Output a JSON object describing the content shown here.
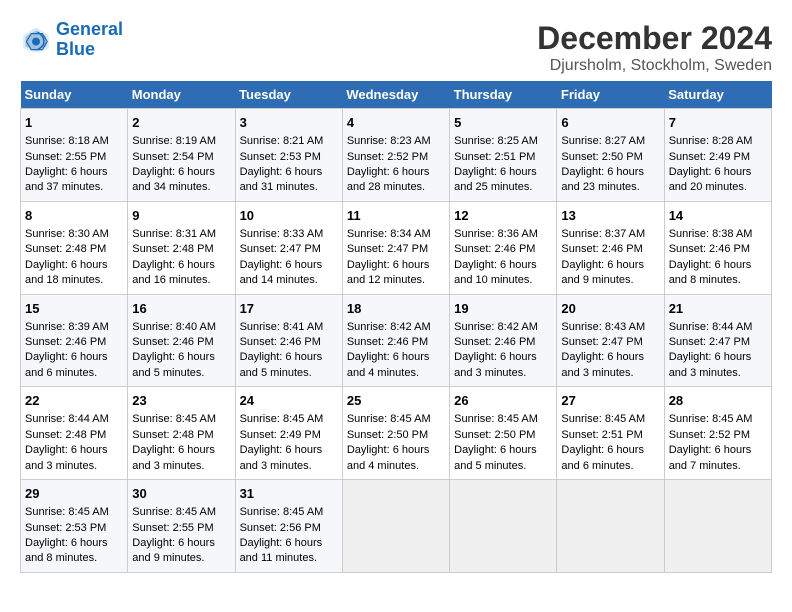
{
  "logo": {
    "line1": "General",
    "line2": "Blue"
  },
  "title": "December 2024",
  "subtitle": "Djursholm, Stockholm, Sweden",
  "days_header": [
    "Sunday",
    "Monday",
    "Tuesday",
    "Wednesday",
    "Thursday",
    "Friday",
    "Saturday"
  ],
  "weeks": [
    [
      {
        "day": "1",
        "sunrise": "8:18 AM",
        "sunset": "2:55 PM",
        "daylight": "6 hours and 37 minutes."
      },
      {
        "day": "2",
        "sunrise": "8:19 AM",
        "sunset": "2:54 PM",
        "daylight": "6 hours and 34 minutes."
      },
      {
        "day": "3",
        "sunrise": "8:21 AM",
        "sunset": "2:53 PM",
        "daylight": "6 hours and 31 minutes."
      },
      {
        "day": "4",
        "sunrise": "8:23 AM",
        "sunset": "2:52 PM",
        "daylight": "6 hours and 28 minutes."
      },
      {
        "day": "5",
        "sunrise": "8:25 AM",
        "sunset": "2:51 PM",
        "daylight": "6 hours and 25 minutes."
      },
      {
        "day": "6",
        "sunrise": "8:27 AM",
        "sunset": "2:50 PM",
        "daylight": "6 hours and 23 minutes."
      },
      {
        "day": "7",
        "sunrise": "8:28 AM",
        "sunset": "2:49 PM",
        "daylight": "6 hours and 20 minutes."
      }
    ],
    [
      {
        "day": "8",
        "sunrise": "8:30 AM",
        "sunset": "2:48 PM",
        "daylight": "6 hours and 18 minutes."
      },
      {
        "day": "9",
        "sunrise": "8:31 AM",
        "sunset": "2:48 PM",
        "daylight": "6 hours and 16 minutes."
      },
      {
        "day": "10",
        "sunrise": "8:33 AM",
        "sunset": "2:47 PM",
        "daylight": "6 hours and 14 minutes."
      },
      {
        "day": "11",
        "sunrise": "8:34 AM",
        "sunset": "2:47 PM",
        "daylight": "6 hours and 12 minutes."
      },
      {
        "day": "12",
        "sunrise": "8:36 AM",
        "sunset": "2:46 PM",
        "daylight": "6 hours and 10 minutes."
      },
      {
        "day": "13",
        "sunrise": "8:37 AM",
        "sunset": "2:46 PM",
        "daylight": "6 hours and 9 minutes."
      },
      {
        "day": "14",
        "sunrise": "8:38 AM",
        "sunset": "2:46 PM",
        "daylight": "6 hours and 8 minutes."
      }
    ],
    [
      {
        "day": "15",
        "sunrise": "8:39 AM",
        "sunset": "2:46 PM",
        "daylight": "6 hours and 6 minutes."
      },
      {
        "day": "16",
        "sunrise": "8:40 AM",
        "sunset": "2:46 PM",
        "daylight": "6 hours and 5 minutes."
      },
      {
        "day": "17",
        "sunrise": "8:41 AM",
        "sunset": "2:46 PM",
        "daylight": "6 hours and 5 minutes."
      },
      {
        "day": "18",
        "sunrise": "8:42 AM",
        "sunset": "2:46 PM",
        "daylight": "6 hours and 4 minutes."
      },
      {
        "day": "19",
        "sunrise": "8:42 AM",
        "sunset": "2:46 PM",
        "daylight": "6 hours and 3 minutes."
      },
      {
        "day": "20",
        "sunrise": "8:43 AM",
        "sunset": "2:47 PM",
        "daylight": "6 hours and 3 minutes."
      },
      {
        "day": "21",
        "sunrise": "8:44 AM",
        "sunset": "2:47 PM",
        "daylight": "6 hours and 3 minutes."
      }
    ],
    [
      {
        "day": "22",
        "sunrise": "8:44 AM",
        "sunset": "2:48 PM",
        "daylight": "6 hours and 3 minutes."
      },
      {
        "day": "23",
        "sunrise": "8:45 AM",
        "sunset": "2:48 PM",
        "daylight": "6 hours and 3 minutes."
      },
      {
        "day": "24",
        "sunrise": "8:45 AM",
        "sunset": "2:49 PM",
        "daylight": "6 hours and 3 minutes."
      },
      {
        "day": "25",
        "sunrise": "8:45 AM",
        "sunset": "2:50 PM",
        "daylight": "6 hours and 4 minutes."
      },
      {
        "day": "26",
        "sunrise": "8:45 AM",
        "sunset": "2:50 PM",
        "daylight": "6 hours and 5 minutes."
      },
      {
        "day": "27",
        "sunrise": "8:45 AM",
        "sunset": "2:51 PM",
        "daylight": "6 hours and 6 minutes."
      },
      {
        "day": "28",
        "sunrise": "8:45 AM",
        "sunset": "2:52 PM",
        "daylight": "6 hours and 7 minutes."
      }
    ],
    [
      {
        "day": "29",
        "sunrise": "8:45 AM",
        "sunset": "2:53 PM",
        "daylight": "6 hours and 8 minutes."
      },
      {
        "day": "30",
        "sunrise": "8:45 AM",
        "sunset": "2:55 PM",
        "daylight": "6 hours and 9 minutes."
      },
      {
        "day": "31",
        "sunrise": "8:45 AM",
        "sunset": "2:56 PM",
        "daylight": "6 hours and 11 minutes."
      },
      null,
      null,
      null,
      null
    ]
  ],
  "labels": {
    "sunrise": "Sunrise:",
    "sunset": "Sunset:",
    "daylight": "Daylight:"
  }
}
